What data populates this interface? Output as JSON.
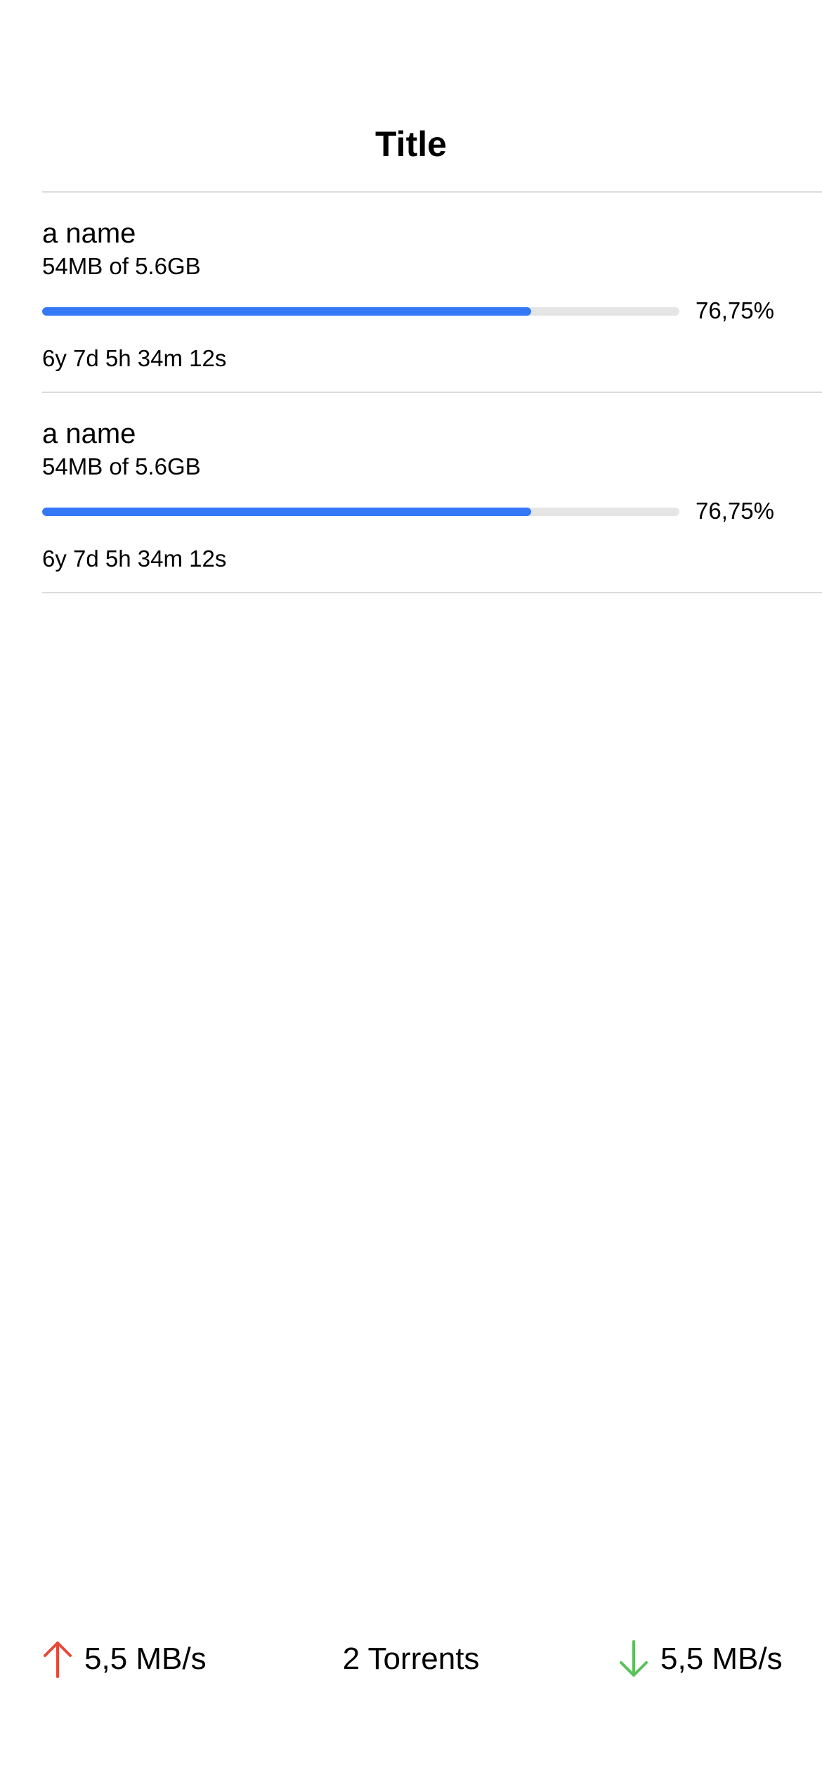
{
  "header": {
    "title": "Title"
  },
  "torrents": [
    {
      "name": "a name",
      "size_text": "54MB of 5.6GB",
      "progress_text": "76,75%",
      "progress": 0.7675,
      "eta": "6y 7d 5h 34m 12s"
    },
    {
      "name": "a name",
      "size_text": "54MB of 5.6GB",
      "progress_text": "76,75%",
      "progress": 0.7675,
      "eta": "6y 7d 5h 34m 12s"
    }
  ],
  "status_bar": {
    "upload_icon": "arrow-up-icon",
    "upload_speed": "5,5 MB/s",
    "torrent_count": "2 Torrents",
    "download_icon": "arrow-down-icon",
    "download_speed": "5,5 MB/s"
  },
  "colors": {
    "accent": "#3478f6",
    "upload": "#e5493a",
    "download": "#5ac15a",
    "track": "#e5e5e5",
    "separator": "#dcdcdc"
  }
}
